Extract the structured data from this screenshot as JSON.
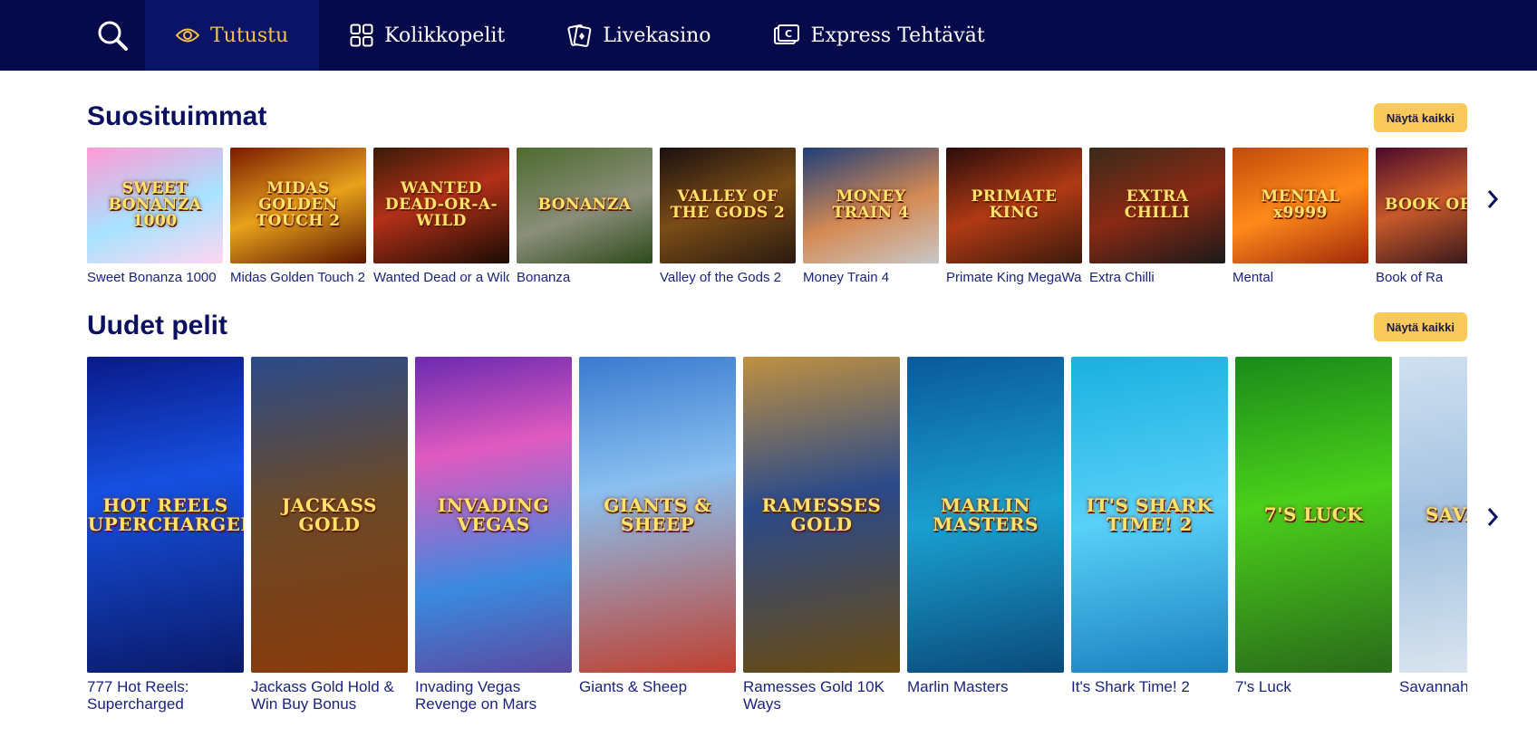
{
  "nav": {
    "items": [
      {
        "label": "Tutustu",
        "icon": "eye-icon",
        "active": true
      },
      {
        "label": "Kolikkopelit",
        "icon": "grid-icon",
        "active": false
      },
      {
        "label": "Livekasino",
        "icon": "cards-icon",
        "active": false
      },
      {
        "label": "Express Tehtävät",
        "icon": "ticket-icon",
        "active": false
      }
    ]
  },
  "popular": {
    "title": "Suosituimmat",
    "show_all": "Näytä kaikki",
    "games": [
      {
        "label": "Sweet Bonanza 1000",
        "art": "SWEET BONANZA 1000"
      },
      {
        "label": "Midas Golden Touch 2",
        "art": "MIDAS GOLDEN TOUCH 2"
      },
      {
        "label": "Wanted Dead or a Wild",
        "art": "WANTED DEAD-OR-A-WILD"
      },
      {
        "label": "Bonanza",
        "art": "BONANZA"
      },
      {
        "label": "Valley of the Gods 2",
        "art": "VALLEY OF THE GODS 2"
      },
      {
        "label": "Money Train 4",
        "art": "MONEY TRAIN 4"
      },
      {
        "label": "Primate King MegaWays",
        "art": "PRIMATE KING"
      },
      {
        "label": "Extra Chilli",
        "art": "EXTRA CHILLI"
      },
      {
        "label": "Mental",
        "art": "MENTAL x9999"
      },
      {
        "label": "Book of Ra",
        "art": "BOOK OF RA"
      }
    ]
  },
  "newgames": {
    "title": "Uudet pelit",
    "show_all": "Näytä kaikki",
    "games": [
      {
        "label": "777 Hot Reels: Supercharged",
        "art": "HOT REELS SUPERCHARGED"
      },
      {
        "label": "Jackass Gold Hold & Win Buy Bonus",
        "art": "JACKASS GOLD"
      },
      {
        "label": "Invading Vegas Revenge on Mars",
        "art": "INVADING VEGAS"
      },
      {
        "label": "Giants & Sheep",
        "art": "GIANTS & SHEEP"
      },
      {
        "label": "Ramesses Gold 10K Ways",
        "art": "RAMESSES GOLD"
      },
      {
        "label": "Marlin Masters",
        "art": "MARLIN MASTERS"
      },
      {
        "label": "It's Shark Time! 2",
        "art": "IT'S SHARK TIME! 2"
      },
      {
        "label": "7's Luck",
        "art": "7'S LUCK"
      },
      {
        "label": "Savannah",
        "art": "SAVA LEG"
      }
    ]
  }
}
